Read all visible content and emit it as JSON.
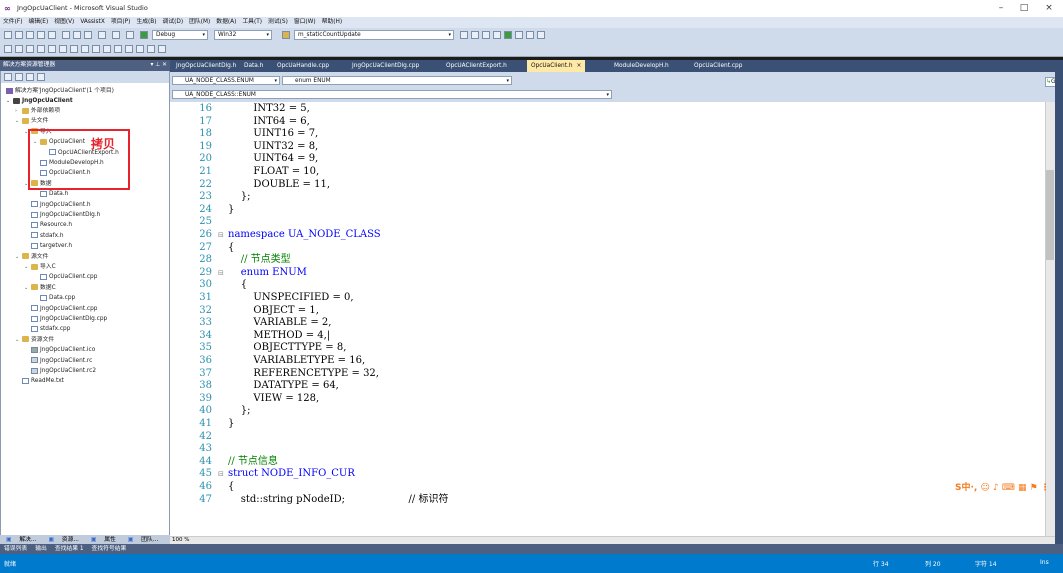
{
  "window": {
    "title": "JngOpcUaClient - Microsoft Visual Studio",
    "minimize": "–",
    "maximize": "□",
    "close": "×"
  },
  "menu": [
    "文件(F)",
    "编辑(E)",
    "视图(V)",
    "VAssistX",
    "项目(P)",
    "生成(B)",
    "调试(D)",
    "团队(M)",
    "数据(A)",
    "工具(T)",
    "测试(S)",
    "窗口(W)",
    "帮助(H)"
  ],
  "toolbar": {
    "config": "Debug",
    "platform": "Win32",
    "find_combo": "m_staticCountUpdate"
  },
  "solution_explorer": {
    "header": "解决方案资源管理器",
    "pin": "▾ ⊥ ✕",
    "solution": "解决方案'JngOpcUaClient'(1 个项目)",
    "project": "JngOpcUaClient",
    "items": [
      {
        "label": "外部依赖项",
        "indent": 1,
        "icon": "folder",
        "expand": "›"
      },
      {
        "label": "头文件",
        "indent": 1,
        "icon": "folder",
        "expand": "⌄"
      },
      {
        "label": "导入",
        "indent": 2,
        "icon": "folder",
        "expand": "⌄"
      },
      {
        "label": "OpcUaClient",
        "indent": 3,
        "icon": "folder",
        "expand": "⌄"
      },
      {
        "label": "OpcUAClientExport.h",
        "indent": 4,
        "icon": "h"
      },
      {
        "label": "ModuleDevelopH.h",
        "indent": 3,
        "icon": "h"
      },
      {
        "label": "OpcUaClient.h",
        "indent": 3,
        "icon": "h"
      },
      {
        "label": "数据",
        "indent": 2,
        "icon": "folder",
        "expand": "⌄"
      },
      {
        "label": "Data.h",
        "indent": 3,
        "icon": "h"
      },
      {
        "label": "JngOpcUaClient.h",
        "indent": 2,
        "icon": "h"
      },
      {
        "label": "JngOpcUaClientDlg.h",
        "indent": 2,
        "icon": "h"
      },
      {
        "label": "Resource.h",
        "indent": 2,
        "icon": "h"
      },
      {
        "label": "stdafx.h",
        "indent": 2,
        "icon": "h"
      },
      {
        "label": "targetver.h",
        "indent": 2,
        "icon": "h"
      },
      {
        "label": "源文件",
        "indent": 1,
        "icon": "folder",
        "expand": "⌄"
      },
      {
        "label": "导入C",
        "indent": 2,
        "icon": "folder",
        "expand": "⌄"
      },
      {
        "label": "OpcUaClient.cpp",
        "indent": 3,
        "icon": "cpp"
      },
      {
        "label": "数据C",
        "indent": 2,
        "icon": "folder",
        "expand": "⌄"
      },
      {
        "label": "Data.cpp",
        "indent": 3,
        "icon": "cpp"
      },
      {
        "label": "JngOpcUaClient.cpp",
        "indent": 2,
        "icon": "cpp"
      },
      {
        "label": "JngOpcUaClientDlg.cpp",
        "indent": 2,
        "icon": "cpp"
      },
      {
        "label": "stdafx.cpp",
        "indent": 2,
        "icon": "cpp"
      },
      {
        "label": "资源文件",
        "indent": 1,
        "icon": "folder",
        "expand": "⌄"
      },
      {
        "label": "JngOpcUaClient.ico",
        "indent": 2,
        "icon": "ico"
      },
      {
        "label": "JngOpcUaClient.rc",
        "indent": 2,
        "icon": "rc"
      },
      {
        "label": "JngOpcUaClient.rc2",
        "indent": 2,
        "icon": "rc"
      },
      {
        "label": "ReadMe.txt",
        "indent": 1,
        "icon": "txt"
      }
    ],
    "annotation": "拷贝",
    "bottom_tabs": [
      "解决...",
      "资源...",
      "属性",
      "团队..."
    ]
  },
  "tabs": [
    "JngOpcUaClientDlg.h",
    "Data.h",
    "OpcUaHandle.cpp",
    "JngOpcUaClientDlg.cpp",
    "OpcUAClientExport.h",
    "OpcUaClient.h",
    "ModuleDevelopH.h",
    "OpcUaClient.cpp"
  ],
  "active_tab": "OpcUaClient.h",
  "tab_close": "×",
  "nav": {
    "scope": "UA_NODE_CLASS.ENUM",
    "member": "enum ENUM",
    "path": "UA_NODE_CLASS::ENUM",
    "go": "Go"
  },
  "code_lines": [
    {
      "n": "16",
      "t": "        INT32 = 5,"
    },
    {
      "n": "17",
      "t": "        INT64 = 6,"
    },
    {
      "n": "18",
      "t": "        UINT16 = 7,"
    },
    {
      "n": "19",
      "t": "        UINT32 = 8,"
    },
    {
      "n": "20",
      "t": "        UINT64 = 9,"
    },
    {
      "n": "21",
      "t": "        FLOAT = 10,"
    },
    {
      "n": "22",
      "t": "        DOUBLE = 11,"
    },
    {
      "n": "23",
      "t": "    };"
    },
    {
      "n": "24",
      "t": "}"
    },
    {
      "n": "25",
      "t": ""
    },
    {
      "n": "26",
      "t": "namespace UA_NODE_CLASS"
    },
    {
      "n": "27",
      "t": "{"
    },
    {
      "n": "28",
      "t": "    // 节点类型"
    },
    {
      "n": "29",
      "t": "    enum ENUM"
    },
    {
      "n": "30",
      "t": "    {"
    },
    {
      "n": "31",
      "t": "        UNSPECIFIED = 0,"
    },
    {
      "n": "32",
      "t": "        OBJECT = 1,"
    },
    {
      "n": "33",
      "t": "        VARIABLE = 2,"
    },
    {
      "n": "34",
      "t": "        METHOD = 4,|"
    },
    {
      "n": "35",
      "t": "        OBJECTTYPE = 8,"
    },
    {
      "n": "36",
      "t": "        VARIABLETYPE = 16,"
    },
    {
      "n": "37",
      "t": "        REFERENCETYPE = 32,"
    },
    {
      "n": "38",
      "t": "        DATATYPE = 64,"
    },
    {
      "n": "39",
      "t": "        VIEW = 128,"
    },
    {
      "n": "40",
      "t": "    };"
    },
    {
      "n": "41",
      "t": "}"
    },
    {
      "n": "42",
      "t": ""
    },
    {
      "n": "43",
      "t": ""
    },
    {
      "n": "44",
      "t": "// 节点信息"
    },
    {
      "n": "45",
      "t": "struct NODE_INFO_CUR"
    },
    {
      "n": "46",
      "t": "{"
    },
    {
      "n": "47",
      "t": "    std::string pNodeID;                    // 标识符"
    }
  ],
  "zoom": "100 %",
  "bottom_panel_tabs": [
    "错误列表",
    "输出",
    "查找结果 1",
    "查找符号结果"
  ],
  "status": {
    "left": "就绪",
    "line": "行 34",
    "col": "列 20",
    "ch": "字符 14",
    "ins": "Ins"
  },
  "ime": "S中·, ☺ ♪ ⌨ ▦ ⚑ ⋮"
}
